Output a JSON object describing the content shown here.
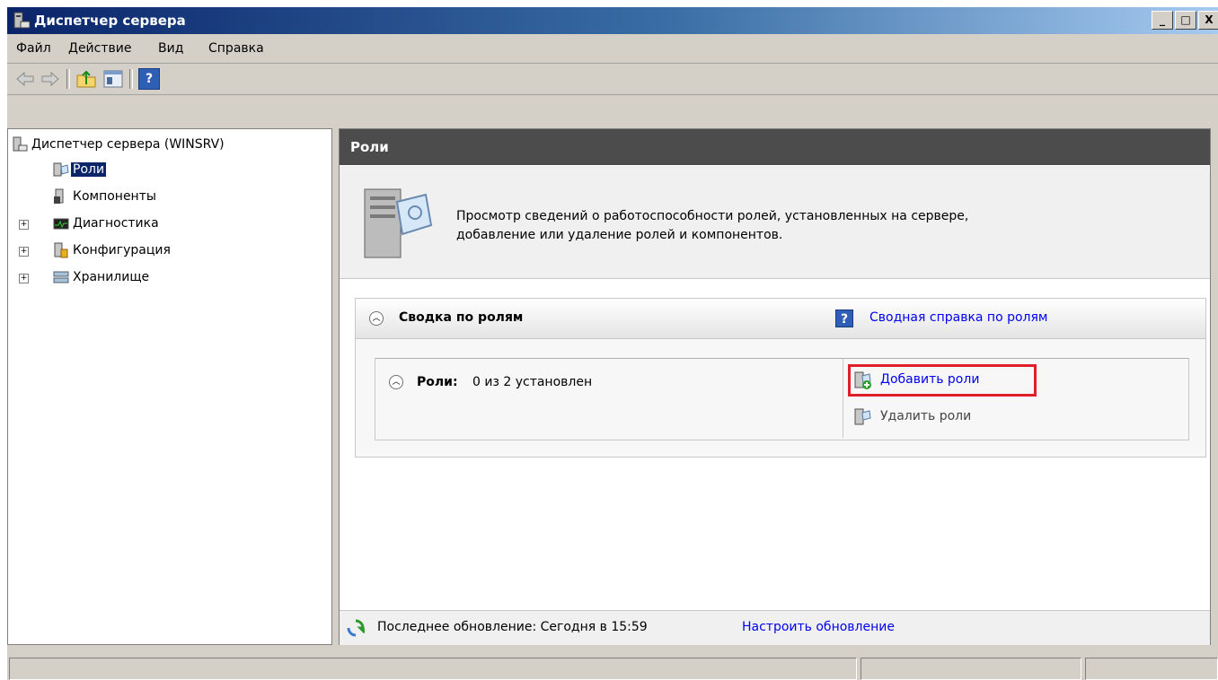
{
  "window": {
    "title": "Диспетчер сервера",
    "buttons": [
      "_",
      "□",
      "X"
    ]
  },
  "menu": {
    "items": [
      "Файл",
      "Действие",
      "Вид",
      "Справка"
    ]
  },
  "toolbar": {
    "icons": [
      "back-arrow-icon",
      "forward-arrow-icon",
      "up-folder-icon",
      "console-tree-icon",
      "help-icon"
    ],
    "help_glyph": "?"
  },
  "tree": {
    "root": "Диспетчер сервера (WINSRV)",
    "items": [
      {
        "label": "Роли",
        "selected": true,
        "expandable": false
      },
      {
        "label": "Компоненты",
        "expandable": false
      },
      {
        "label": "Диагностика",
        "expandable": true
      },
      {
        "label": "Конфигурация",
        "expandable": true
      },
      {
        "label": "Хранилище",
        "expandable": true
      }
    ],
    "expander_glyph": "+"
  },
  "pane": {
    "header": "Роли",
    "description_line1": "Просмотр сведений о работоспособности ролей, установленных на сервере,",
    "description_line2": "добавление или удаление ролей и компонентов.",
    "summary": {
      "title": "Сводка по ролям",
      "help_link": "Сводная справка по ролям",
      "help_glyph": "?",
      "roles_label": "Роли:",
      "roles_value": "0 из 2 установлен",
      "add_roles": "Добавить роли",
      "remove_roles": "Удалить роли"
    },
    "footer": {
      "last_update": "Последнее обновление: Сегодня в 15:59",
      "configure_link": "Настроить обновление"
    }
  },
  "colors": {
    "title_bar": "#0a246a",
    "pane_header": "#4c4c4c",
    "link": "#0000ee",
    "highlight": "#e01e2a",
    "selection": "#0a246a"
  }
}
